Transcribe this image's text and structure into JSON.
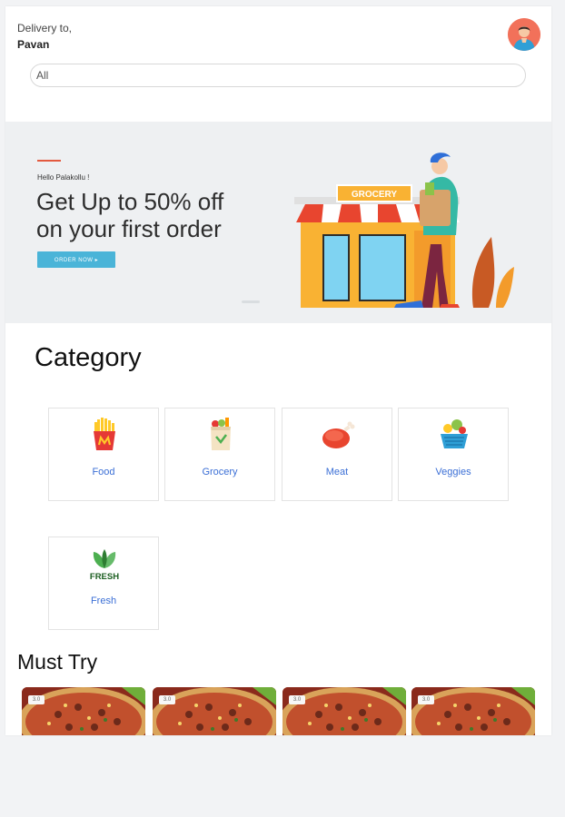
{
  "header": {
    "delivery_label": "Delivery to,",
    "delivery_name": "Pavan",
    "search_value": "All"
  },
  "banner": {
    "hello": "Hello Palakollu !",
    "title_line1": "Get Up to 50% off",
    "title_line2": "on your first order",
    "button": "ORDER NOW ▸",
    "shop_sign": "GROCERY"
  },
  "category": {
    "title": "Category",
    "items": [
      {
        "label": "Food",
        "icon": "fries-icon"
      },
      {
        "label": "Grocery",
        "icon": "grocery-bag-icon"
      },
      {
        "label": "Meat",
        "icon": "meat-icon"
      },
      {
        "label": "Veggies",
        "icon": "veggies-basket-icon"
      },
      {
        "label": "Fresh",
        "icon": "fresh-leaf-icon",
        "icon_text": "FRESH"
      }
    ]
  },
  "must_try": {
    "title": "Must Try",
    "items": [
      {
        "badge": "3.0"
      },
      {
        "badge": "3.0"
      },
      {
        "badge": "3.0"
      },
      {
        "badge": "3.0"
      }
    ]
  },
  "colors": {
    "accent": "#4ab4d8",
    "category_label": "#3b6fd6",
    "avatar_bg": "#f2715a"
  }
}
